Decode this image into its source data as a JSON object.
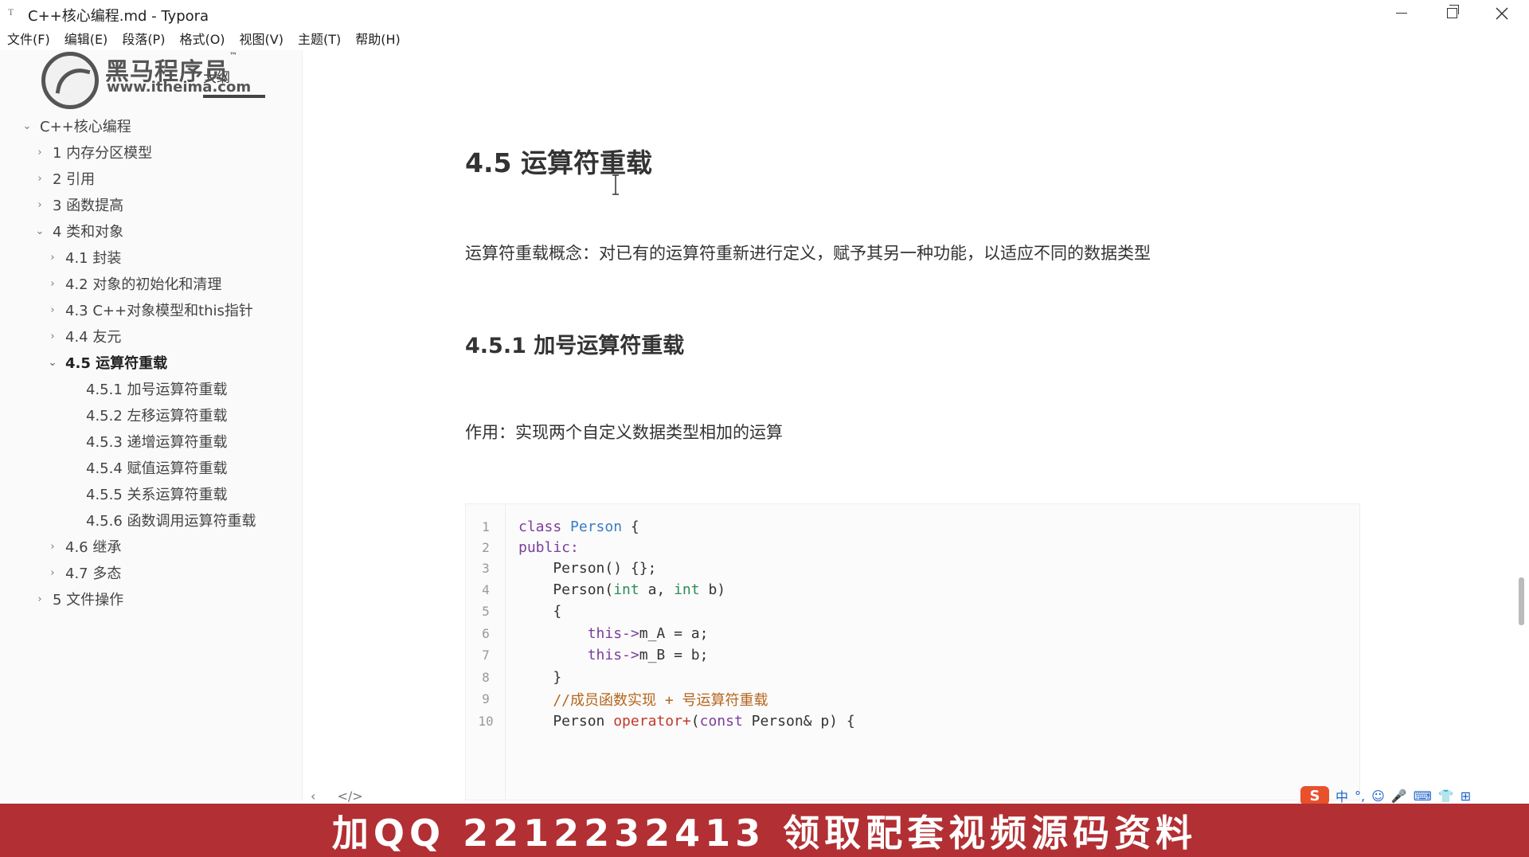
{
  "window": {
    "app_icon": "T",
    "title": "C++核心编程.md - Typora"
  },
  "menu": [
    "文件(F)",
    "编辑(E)",
    "段落(P)",
    "格式(O)",
    "视图(V)",
    "主题(T)",
    "帮助(H)"
  ],
  "sidebar": {
    "tab_label": "大纲",
    "logo_cn": "黑马程序员",
    "logo_tm": "™",
    "logo_url": "www.itheima.com",
    "toc": [
      {
        "label": "C++核心编程",
        "level": 0,
        "expanded": true
      },
      {
        "label": "1 内存分区模型",
        "level": 1,
        "expanded": false
      },
      {
        "label": "2 引用",
        "level": 1,
        "expanded": false
      },
      {
        "label": "3 函数提高",
        "level": 1,
        "expanded": false
      },
      {
        "label": "4 类和对象",
        "level": 1,
        "expanded": true
      },
      {
        "label": "4.1 封装",
        "level": 2,
        "expanded": false
      },
      {
        "label": "4.2 对象的初始化和清理",
        "level": 2,
        "expanded": false
      },
      {
        "label": "4.3 C++对象模型和this指针",
        "level": 2,
        "expanded": false
      },
      {
        "label": "4.4 友元",
        "level": 2,
        "expanded": false
      },
      {
        "label": "4.5 运算符重载",
        "level": 2,
        "expanded": true,
        "active": true
      },
      {
        "label": "4.5.1 加号运算符重载",
        "level": 3
      },
      {
        "label": "4.5.2 左移运算符重载",
        "level": 3
      },
      {
        "label": "4.5.3 递增运算符重载",
        "level": 3
      },
      {
        "label": "4.5.4 赋值运算符重载",
        "level": 3
      },
      {
        "label": "4.5.5 关系运算符重载",
        "level": 3
      },
      {
        "label": "4.5.6 函数调用运算符重载",
        "level": 3
      },
      {
        "label": "4.6 继承",
        "level": 2,
        "expanded": false
      },
      {
        "label": "4.7 多态",
        "level": 2,
        "expanded": false
      },
      {
        "label": "5 文件操作",
        "level": 1,
        "expanded": false
      }
    ]
  },
  "document": {
    "h2": "4.5 运算符重载",
    "para1": "运算符重载概念：对已有的运算符重新进行定义，赋予其另一种功能，以适应不同的数据类型",
    "h3": "4.5.1 加号运算符重载",
    "para2": "作用：实现两个自定义数据类型相加的运算",
    "code_lines": [
      "class Person {",
      "public:",
      "    Person() {};",
      "    Person(int a, int b)",
      "    {",
      "        this->m_A = a;",
      "        this->m_B = b;",
      "    }",
      "    //成员函数实现 + 号运算符重载",
      "    Person operator+(const Person& p) {"
    ]
  },
  "statusbar": {
    "back_icon": "‹",
    "source_icon": "</>"
  },
  "ime": {
    "logo": "S",
    "items": [
      "中",
      "°,",
      "☺",
      "🎤",
      "⌨",
      "👕",
      "⊞"
    ]
  },
  "banner": {
    "text": "加QQ 2212232413  领取配套视频源码资料"
  }
}
